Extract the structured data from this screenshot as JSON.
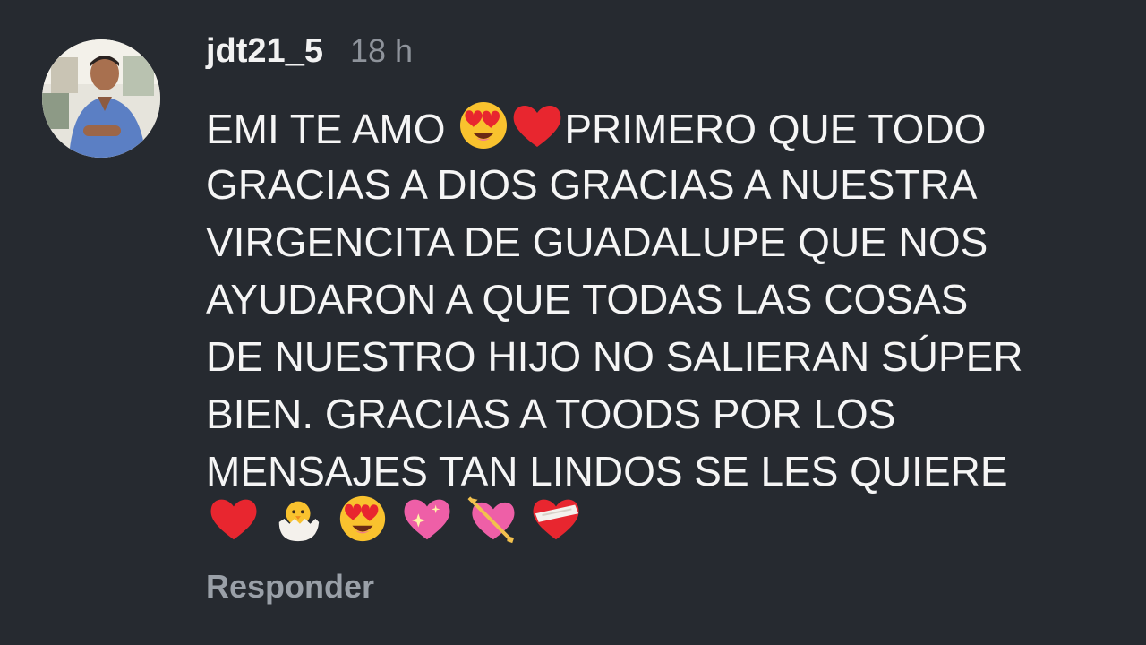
{
  "comment": {
    "username": "jdt21_5",
    "time": "18 h",
    "lines": [
      "EMI TE AMO ",
      "PRIMERO QUE TODO",
      "GRACIAS A DIOS GRACIAS A NUESTRA",
      "VIRGENCITA DE GUADALUPE QUE NOS",
      "AYUDARON A QUE TODAS LAS COSAS",
      "DE NUESTRO HIJO NO SALIERAN SÚPER",
      "BIEN. GRACIAS A TOODS POR LOS",
      "MENSAJES TAN LINDOS SE LES QUIERE"
    ],
    "inline_emojis": [
      "heart-eyes-emoji",
      "red-heart-emoji"
    ],
    "trailing_emojis": [
      "red-heart-emoji",
      "hatching-chick-emoji",
      "heart-eyes-emoji",
      "sparkling-heart-emoji",
      "heart-with-arrow-emoji",
      "mending-heart-emoji"
    ],
    "reply_label": "Responder"
  },
  "colors": {
    "background": "#262a30",
    "text": "#f5f5f5",
    "muted": "#8e939b",
    "reply": "#9aa0a8"
  }
}
